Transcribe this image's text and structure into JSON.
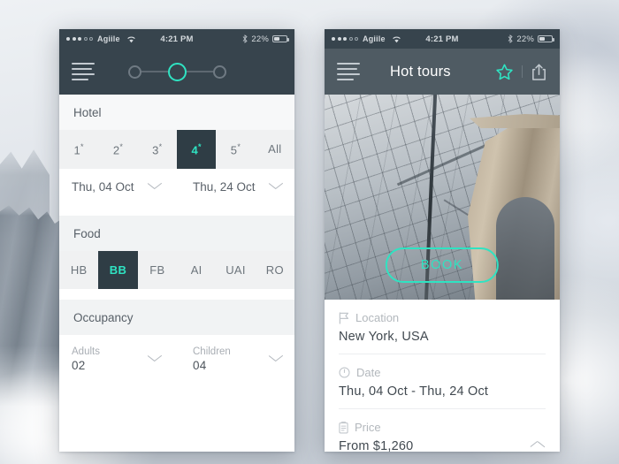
{
  "theme": {
    "accent": "#2fe3c2",
    "dark": "#37444d",
    "selected_bg": "#2f3d45",
    "text_muted": "#b3b8bd"
  },
  "status_bar": {
    "carrier": "Agiile",
    "time": "4:21 PM",
    "battery_percent": "22%",
    "wifi_icon": "wifi-icon",
    "bluetooth_icon": "bluetooth-icon",
    "battery_icon": "battery-icon"
  },
  "left_phone": {
    "nav": {
      "menu_icon": "hamburger-menu-icon",
      "steps": {
        "total": 3,
        "active_index": 1
      }
    },
    "sections": [
      {
        "id": "hotel",
        "title": "Hotel",
        "options": [
          {
            "label": "1",
            "sup": "*",
            "selected": false
          },
          {
            "label": "2",
            "sup": "*",
            "selected": false
          },
          {
            "label": "3",
            "sup": "*",
            "selected": false
          },
          {
            "label": "4",
            "sup": "*",
            "selected": true
          },
          {
            "label": "5",
            "sup": "*",
            "selected": false
          },
          {
            "label": "All",
            "sup": "",
            "selected": false
          }
        ]
      },
      {
        "id": "food",
        "title": "Food",
        "options": [
          {
            "label": "HB",
            "sup": "",
            "selected": false
          },
          {
            "label": "BB",
            "sup": "",
            "selected": true
          },
          {
            "label": "FB",
            "sup": "",
            "selected": false
          },
          {
            "label": "AI",
            "sup": "",
            "selected": false
          },
          {
            "label": "UAI",
            "sup": "",
            "selected": false
          },
          {
            "label": "RO",
            "sup": "",
            "selected": false
          }
        ]
      },
      {
        "id": "occupancy",
        "title": "Occupancy"
      }
    ],
    "date_pickers": [
      {
        "name": "check-in",
        "value": "Thu, 04 Oct",
        "icon": "chevron-down-icon"
      },
      {
        "name": "check-out",
        "value": "Thu, 24 Oct",
        "icon": "chevron-down-icon"
      }
    ],
    "occupancy_pickers": [
      {
        "name": "adults",
        "label": "Adults",
        "value": "02",
        "icon": "chevron-down-icon"
      },
      {
        "name": "children",
        "label": "Children",
        "value": "04",
        "icon": "chevron-down-icon"
      }
    ]
  },
  "right_phone": {
    "nav": {
      "menu_icon": "hamburger-menu-icon",
      "title": "Hot tours",
      "favorite_icon": "star-icon",
      "share_icon": "share-icon"
    },
    "hero": {
      "image_alt": "brooklyn-bridge-photo",
      "book_label": "BOOK"
    },
    "details": [
      {
        "id": "location",
        "icon": "flag-icon",
        "label": "Location",
        "value": "New York, USA"
      },
      {
        "id": "date",
        "icon": "clock-icon",
        "label": "Date",
        "value": "Thu, 04 Oct - Thu, 24 Oct"
      },
      {
        "id": "price",
        "icon": "clipboard-icon",
        "label": "Price",
        "value": "From $1,260",
        "collapse_icon": "chevron-up-icon"
      }
    ]
  }
}
